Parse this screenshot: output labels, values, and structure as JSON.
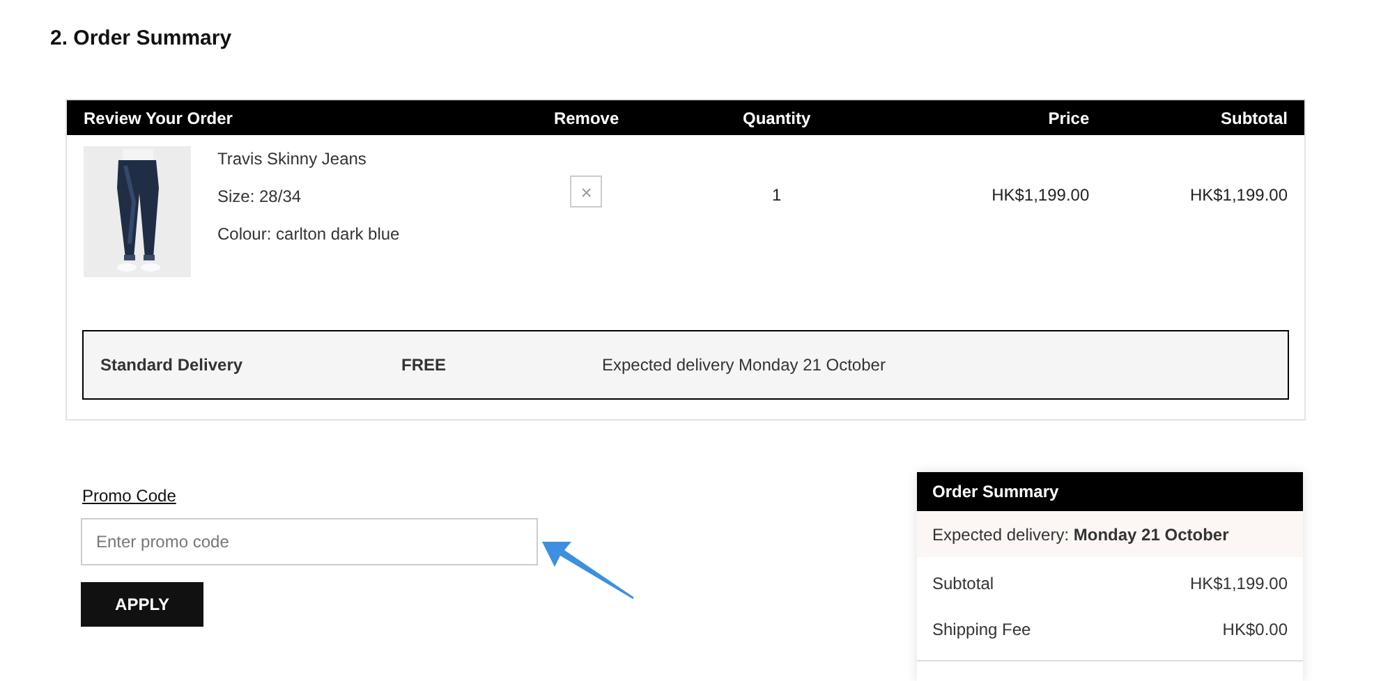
{
  "heading": "2. Order Summary",
  "table": {
    "columns": [
      "Review Your Order",
      "Remove",
      "Quantity",
      "Price",
      "Subtotal"
    ],
    "rows": [
      {
        "name": "Travis Skinny Jeans",
        "size": "Size: 28/34",
        "colour": "Colour: carlton dark blue",
        "remove": "×",
        "quantity": "1",
        "price": "HK$1,199.00",
        "subtotal": "HK$1,199.00"
      }
    ]
  },
  "delivery": {
    "method": "Standard Delivery",
    "cost": "FREE",
    "expected": "Expected delivery Monday 21 October"
  },
  "promo": {
    "label": "Promo Code",
    "placeholder": "Enter promo code",
    "button": "APPLY"
  },
  "summary": {
    "title": "Order Summary",
    "expected": "Expected delivery: **Monday 21 October**",
    "lines": [
      {
        "label": "Subtotal",
        "value": "HK$1,199.00"
      },
      {
        "label": "Shipping Fee",
        "value": "HK$0.00"
      }
    ]
  }
}
